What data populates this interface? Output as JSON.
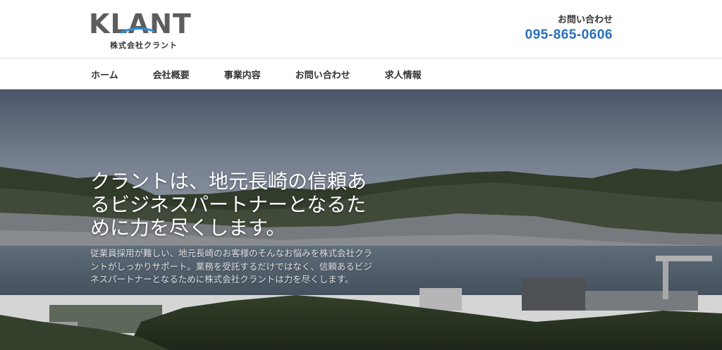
{
  "brand": {
    "logo_text": "KLANT",
    "company_name": "株式会社クラント"
  },
  "contact": {
    "label": "お問い合わせ",
    "phone": "095-865-0606"
  },
  "nav": {
    "items": [
      {
        "label": "ホーム"
      },
      {
        "label": "会社概要"
      },
      {
        "label": "事業内容"
      },
      {
        "label": "お問い合わせ"
      },
      {
        "label": "求人情報"
      }
    ]
  },
  "hero": {
    "headline": "クラントは、地元長崎の信頼あるビジネスパートナーとなるために力を尽くします。",
    "subcopy": "従業員採用が難しい、地元長崎のお客様のそんなお悩みを株式会社クラントがしっかりサポート。業務を受託するだけではなく、信頼あるビジネスパートナーとなるために株式会社クラントは力を尽くします。"
  },
  "colors": {
    "phone": "#2a6ebb",
    "logo_gray": "#5d5d5d",
    "logo_accent": "#2a8fd8"
  }
}
